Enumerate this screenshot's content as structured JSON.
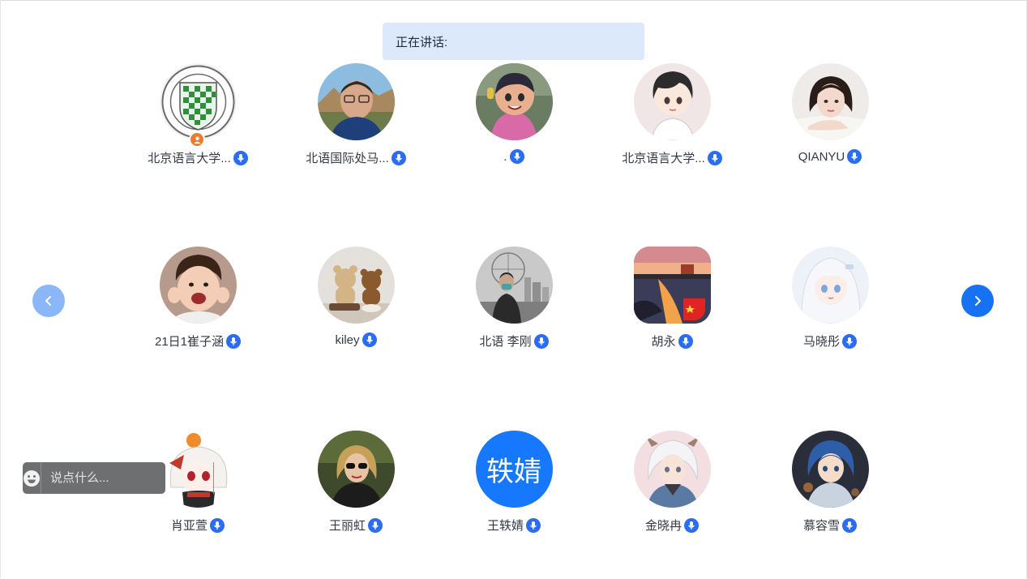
{
  "speaking": {
    "label": "正在讲话:"
  },
  "participants": [
    {
      "name": "北京语言大学...",
      "avatar": "university-seal",
      "badge": "host"
    },
    {
      "name": "北语国际处马...",
      "avatar": "man-glasses-photo"
    },
    {
      "name": ".",
      "avatar": "cartoon-girl"
    },
    {
      "name": "北京语言大学...",
      "avatar": "anime-boy"
    },
    {
      "name": "QIANYU",
      "avatar": "woman-photo"
    },
    {
      "name": "21日1崔子涵",
      "avatar": "child-photo"
    },
    {
      "name": "kiley",
      "avatar": "teddy-bears-photo"
    },
    {
      "name": "北语 李刚",
      "avatar": "man-ferris-wheel-photo"
    },
    {
      "name": "胡永",
      "avatar": "sunset-lake-photo",
      "badge": "flag"
    },
    {
      "name": "马晓彤",
      "avatar": "anime-white-hair-girl"
    },
    {
      "name": "肖亚萱",
      "avatar": "anime-chibi"
    },
    {
      "name": "王丽虹",
      "avatar": "woman-sunglasses-photo"
    },
    {
      "name": "王轶婧",
      "avatar": "text",
      "avatar_text": "轶婧"
    },
    {
      "name": "金晓冉",
      "avatar": "anime-white-hair-man"
    },
    {
      "name": "慕容雪",
      "avatar": "anime-blue-hair-boy"
    }
  ],
  "chat": {
    "placeholder": "说点什么..."
  },
  "colors": {
    "accent": "#1672f3",
    "mic": "#2b6df2",
    "banner": "#dce9fb"
  }
}
